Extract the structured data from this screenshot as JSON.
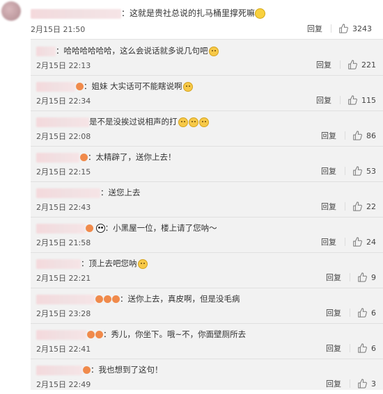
{
  "main": {
    "text": "：这就是贵社总说的扎马桶里撑死嘛",
    "time": "2月15日 21:50",
    "reply_label": "回复",
    "likes": "3243"
  },
  "replies": [
    {
      "text": "：哈哈哈哈哈哈，这么会说话就多说几句吧",
      "time": "2月15日 22:13",
      "reply_label": "回复",
      "likes": "221"
    },
    {
      "text": "：姐妹  大实话可不能瞎说啊",
      "time": "2月15日 22:34",
      "reply_label": "回复",
      "likes": "115"
    },
    {
      "text": "是不是没挨过说相声的打",
      "time": "2月15日 22:08",
      "reply_label": "回复",
      "likes": "86"
    },
    {
      "text": "：太精辟了，送你上去！",
      "time": "2月15日 22:15",
      "reply_label": "回复",
      "likes": "53"
    },
    {
      "text": "：送您上去",
      "time": "2月15日 22:43",
      "reply_label": "回复",
      "likes": "22"
    },
    {
      "text": "：小黑屋一位，楼上请了您呐～",
      "time": "2月15日 21:58",
      "reply_label": "回复",
      "likes": "24"
    },
    {
      "text": "：顶上去吧您呐",
      "time": "2月15日 22:21",
      "reply_label": "回复",
      "likes": "9"
    },
    {
      "text": "：送你上去，真皮啊，但是没毛病",
      "time": "2月15日 23:28",
      "reply_label": "回复",
      "likes": "6"
    },
    {
      "text": "：秀儿，你坐下。哦~不，你面壁厕所去",
      "time": "2月15日 22:41",
      "reply_label": "回复",
      "likes": "6"
    },
    {
      "text": "：我也想到了这句！",
      "time": "2月15日 22:49",
      "reply_label": "回复",
      "likes": "3"
    }
  ]
}
